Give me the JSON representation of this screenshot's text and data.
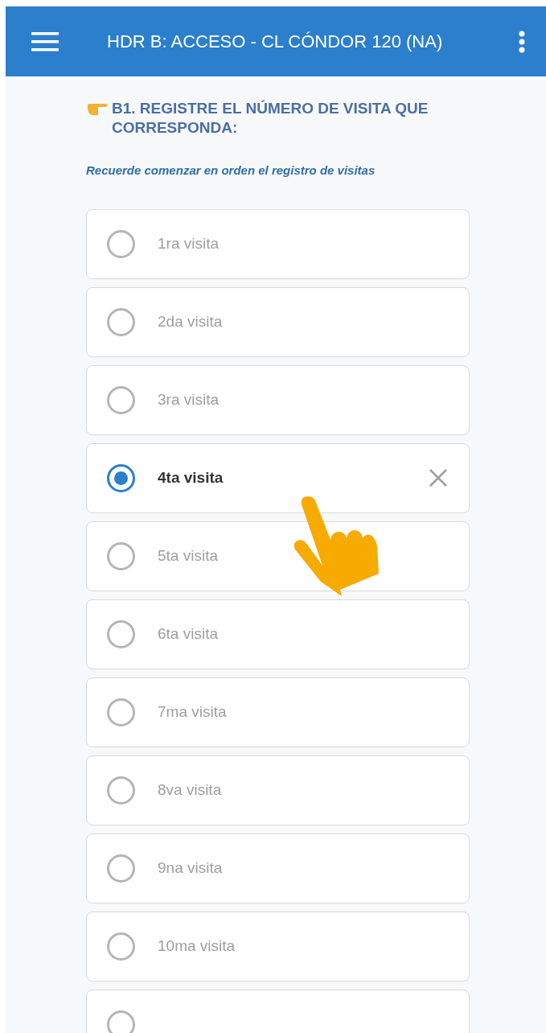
{
  "app_bar": {
    "title": "HDR B: ACCESO - CL CÓNDOR 120 (NA)"
  },
  "question": {
    "title": "B1. REGISTRE EL NÚMERO DE VISITA QUE CORRESPONDA:",
    "hint": "Recuerde comenzar en orden el registro de visitas"
  },
  "options": [
    {
      "label": "1ra visita",
      "selected": false
    },
    {
      "label": "2da visita",
      "selected": false
    },
    {
      "label": "3ra visita",
      "selected": false
    },
    {
      "label": "4ta visita",
      "selected": true
    },
    {
      "label": "5ta visita",
      "selected": false
    },
    {
      "label": "6ta visita",
      "selected": false
    },
    {
      "label": "7ma visita",
      "selected": false
    },
    {
      "label": "8va visita",
      "selected": false
    },
    {
      "label": "9na visita",
      "selected": false
    },
    {
      "label": "10ma visita",
      "selected": false
    }
  ],
  "partial_option": {
    "selected": false
  }
}
